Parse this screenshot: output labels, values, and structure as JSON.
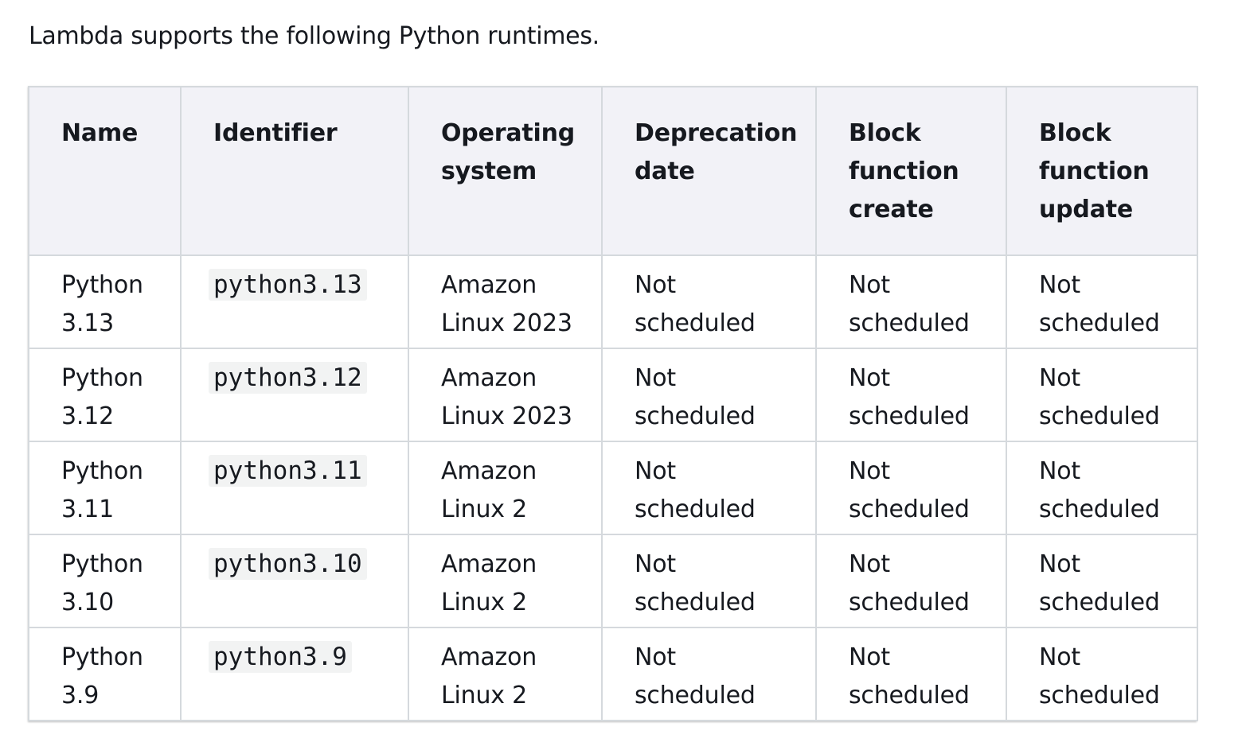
{
  "intro_text": "Lambda supports the following Python runtimes.",
  "table": {
    "headers": [
      "Name",
      "Identifier",
      "Operating system",
      "Deprecation date",
      "Block function create",
      "Block function update"
    ],
    "rows": [
      {
        "name": "Python 3.13",
        "identifier": "python3.13",
        "os": "Amazon Linux 2023",
        "deprecation": "Not scheduled",
        "block_create": "Not scheduled",
        "block_update": "Not scheduled"
      },
      {
        "name": "Python 3.12",
        "identifier": "python3.12",
        "os": "Amazon Linux 2023",
        "deprecation": "Not scheduled",
        "block_create": "Not scheduled",
        "block_update": "Not scheduled"
      },
      {
        "name": "Python 3.11",
        "identifier": "python3.11",
        "os": "Amazon Linux 2",
        "deprecation": "Not scheduled",
        "block_create": "Not scheduled",
        "block_update": "Not scheduled"
      },
      {
        "name": "Python 3.10",
        "identifier": "python3.10",
        "os": "Amazon Linux 2",
        "deprecation": "Not scheduled",
        "block_create": "Not scheduled",
        "block_update": "Not scheduled"
      },
      {
        "name": "Python 3.9",
        "identifier": "python3.9",
        "os": "Amazon Linux 2",
        "deprecation": "Not scheduled",
        "block_create": "Not scheduled",
        "block_update": "Not scheduled"
      }
    ]
  },
  "colors": {
    "text": "#16191f",
    "header_bg": "#f2f2f7",
    "border": "#d5d9dd",
    "code_bg": "#f2f3f3"
  }
}
